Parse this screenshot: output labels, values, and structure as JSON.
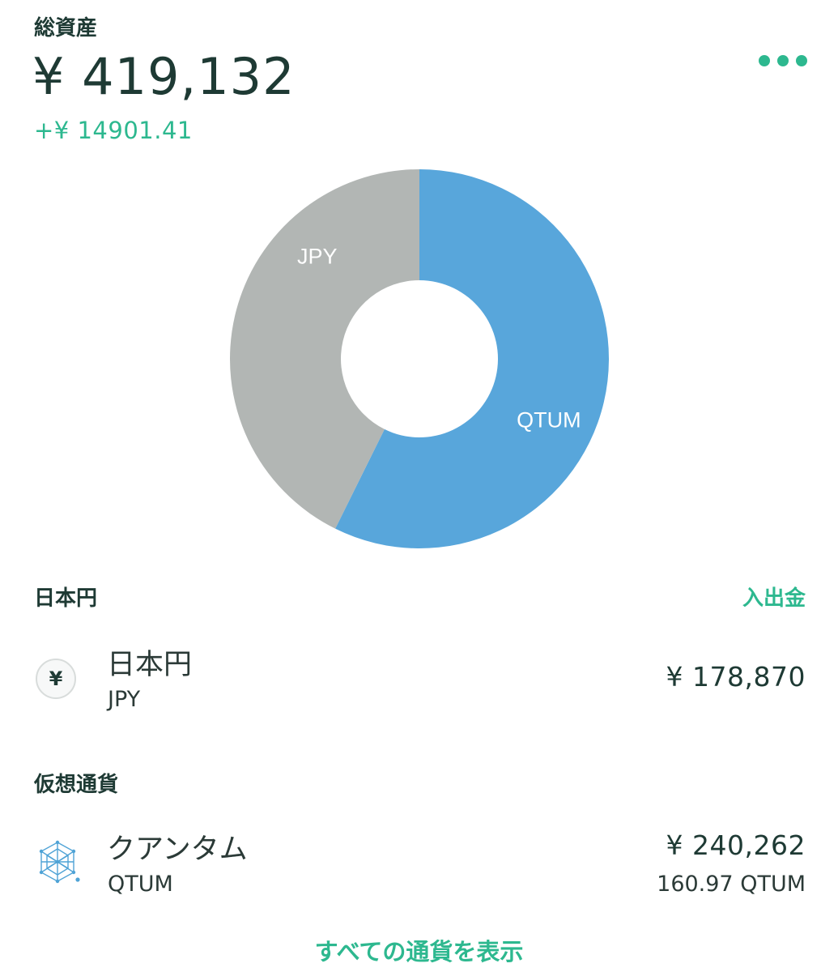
{
  "header": {
    "total_label": "総資産",
    "total_value": "¥ 419,132",
    "total_change": "+¥ 14901.41",
    "more_icon": "more-horizontal-icon"
  },
  "chart_data": {
    "type": "pie",
    "donut": true,
    "slices": [
      {
        "label": "QTUM",
        "value": 240262,
        "color": "#58a6db"
      },
      {
        "label": "JPY",
        "value": 178870,
        "color": "#b2b6b4"
      }
    ]
  },
  "fiat": {
    "title": "日本円",
    "action": "入出金",
    "items": [
      {
        "icon": "yen-icon",
        "icon_glyph": "¥",
        "name": "日本円",
        "code": "JPY",
        "value": "¥ 178,870"
      }
    ]
  },
  "crypto": {
    "title": "仮想通貨",
    "items": [
      {
        "icon": "qtum-icon",
        "name": "クアンタム",
        "code": "QTUM",
        "value": "¥ 240,262",
        "amount": "160.97 QTUM"
      }
    ]
  },
  "footer": {
    "show_all": "すべての通貨を表示"
  },
  "colors": {
    "accent": "#2db88f",
    "text": "#1e3a34"
  }
}
